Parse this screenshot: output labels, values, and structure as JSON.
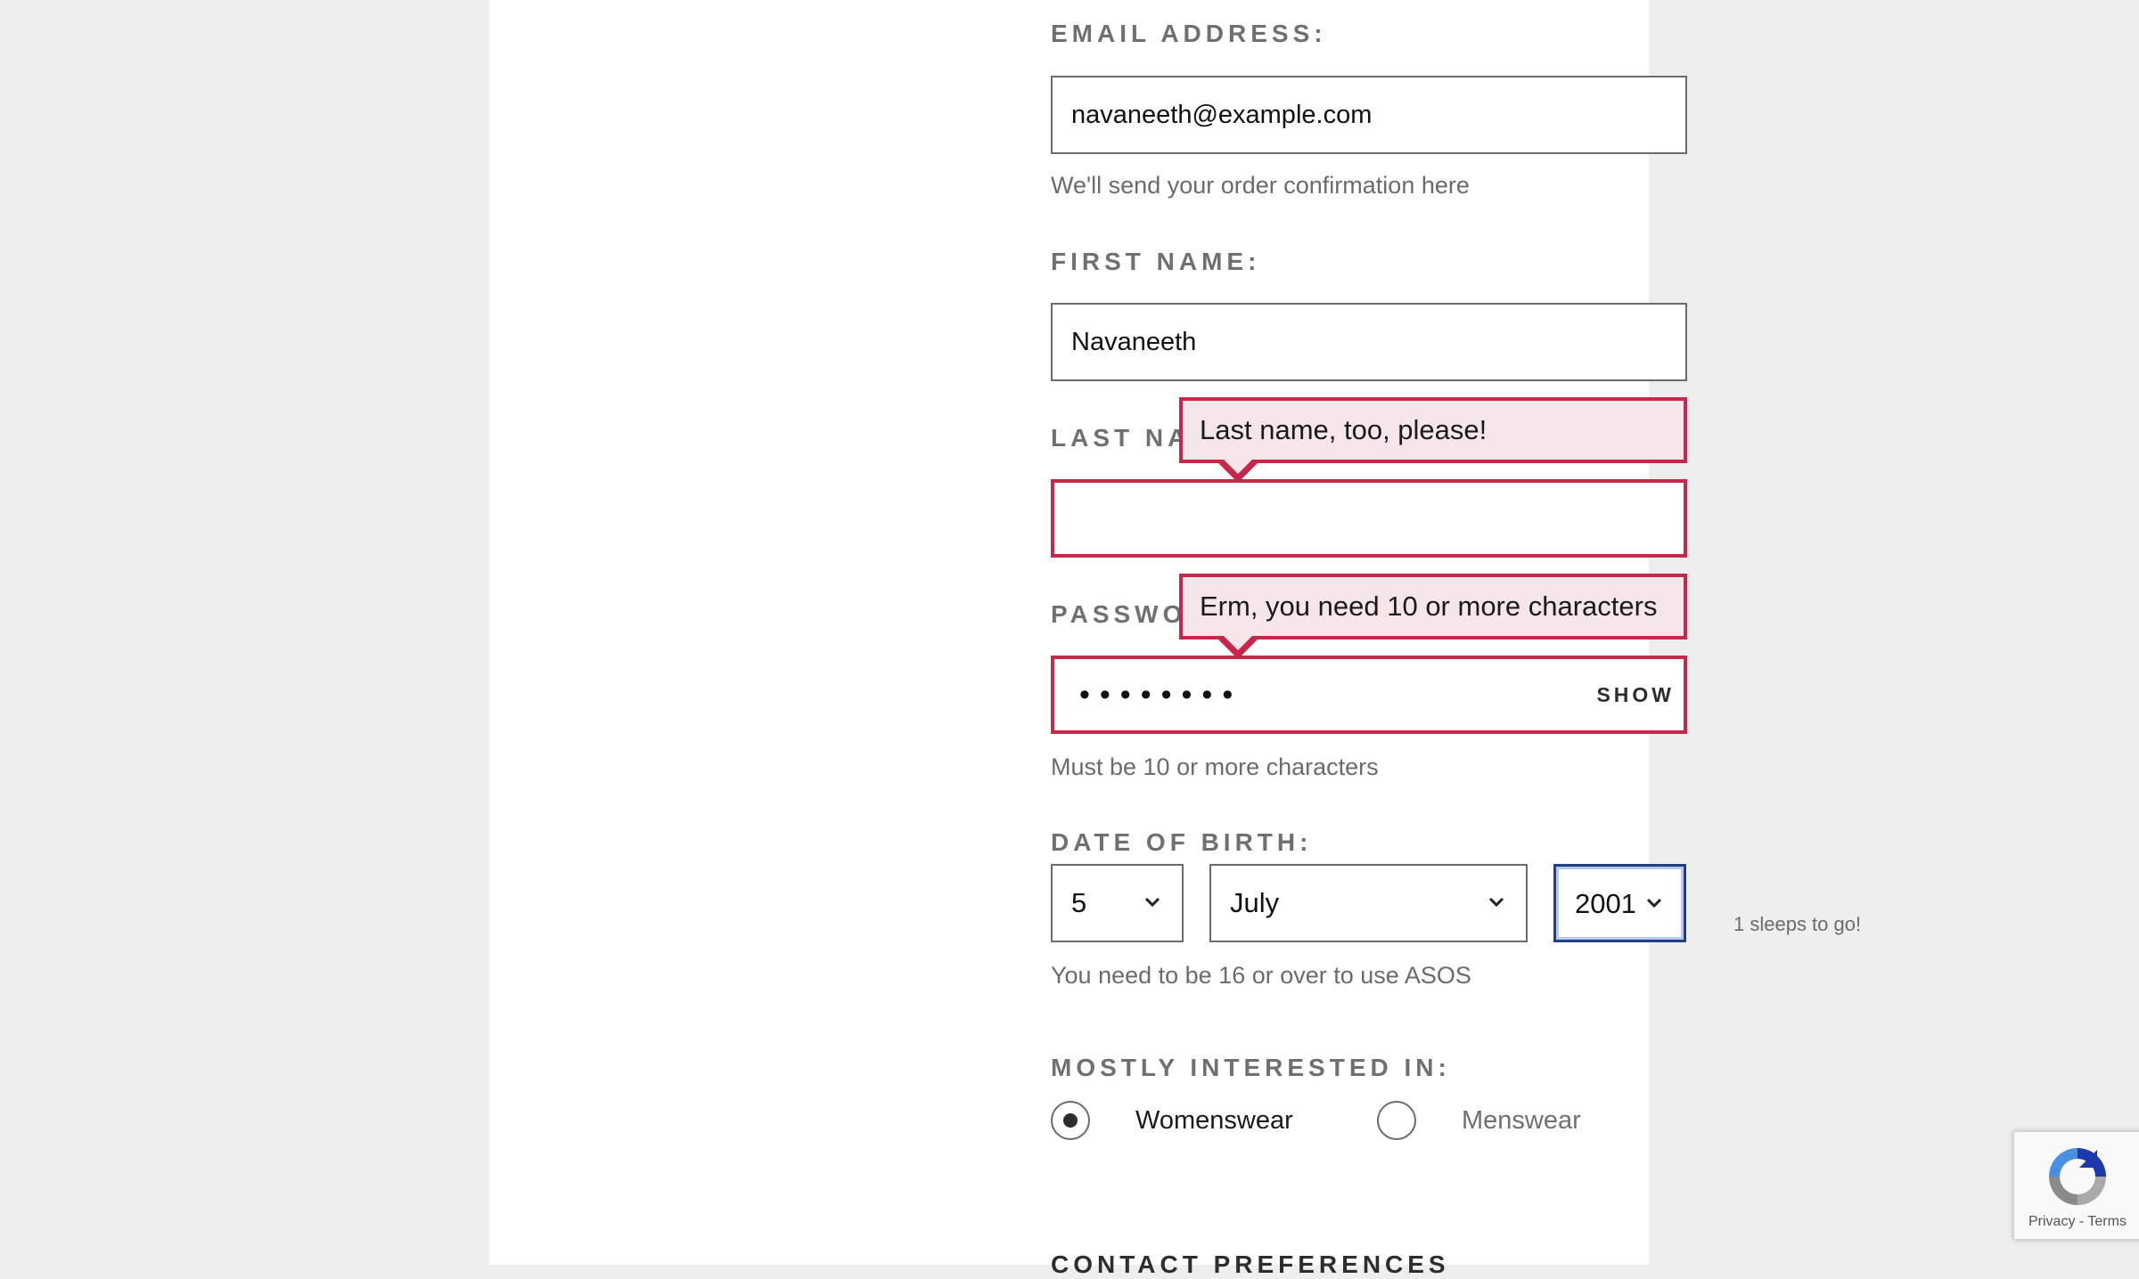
{
  "email": {
    "label": "EMAIL ADDRESS:",
    "value": "navaneeth@example.com",
    "help": "We'll send your order confirmation here"
  },
  "first_name": {
    "label": "FIRST NAME:",
    "value": "Navaneeth"
  },
  "last_name": {
    "label": "LAST NAME:",
    "value": "",
    "error": "Last name, too, please!"
  },
  "password": {
    "label": "PASSWORD:",
    "masked_value": "••••••••",
    "show_label": "SHOW",
    "error": "Erm, you need 10 or more characters",
    "help": "Must be 10 or more characters"
  },
  "dob": {
    "label": "DATE OF BIRTH:",
    "day": "5",
    "month": "July",
    "year": "2001",
    "countdown": "1 sleeps to go!",
    "help": "You need to be 16 or over to use ASOS"
  },
  "interest": {
    "label": "MOSTLY INTERESTED IN:",
    "options": [
      {
        "label": "Womenswear",
        "selected": true
      },
      {
        "label": "Menswear",
        "selected": false
      }
    ]
  },
  "contact": {
    "label": "CONTACT PREFERENCES"
  },
  "recaptcha": {
    "links": "Privacy - Terms"
  },
  "colors": {
    "error": "#c7274a",
    "error_bg": "#f6e6ea",
    "focus": "#1f3f88"
  }
}
